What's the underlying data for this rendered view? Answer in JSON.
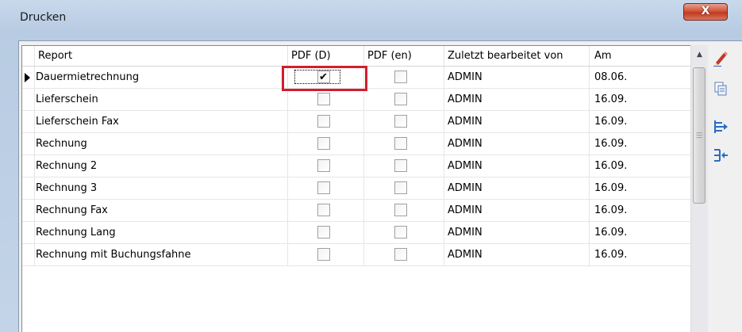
{
  "window": {
    "title": "Drucken",
    "close_label": "X"
  },
  "columns": {
    "report": "Report",
    "pdf_d": "PDF (D)",
    "pdf_en": "PDF (en)",
    "edited_by": "Zuletzt bearbeitet von",
    "date": "Am"
  },
  "rows": [
    {
      "report": "Dauermietrechnung",
      "pdf_d": true,
      "pdf_en": false,
      "edited_by": "ADMIN",
      "date": "08.06.",
      "selected": true
    },
    {
      "report": "Lieferschein",
      "pdf_d": false,
      "pdf_en": false,
      "edited_by": "ADMIN",
      "date": "16.09."
    },
    {
      "report": "Lieferschein Fax",
      "pdf_d": false,
      "pdf_en": false,
      "edited_by": "ADMIN",
      "date": "16.09."
    },
    {
      "report": "Rechnung",
      "pdf_d": false,
      "pdf_en": false,
      "edited_by": "ADMIN",
      "date": "16.09."
    },
    {
      "report": "Rechnung 2",
      "pdf_d": false,
      "pdf_en": false,
      "edited_by": "ADMIN",
      "date": "16.09."
    },
    {
      "report": "Rechnung 3",
      "pdf_d": false,
      "pdf_en": false,
      "edited_by": "ADMIN",
      "date": "16.09."
    },
    {
      "report": "Rechnung Fax",
      "pdf_d": false,
      "pdf_en": false,
      "edited_by": "ADMIN",
      "date": "16.09."
    },
    {
      "report": "Rechnung Lang",
      "pdf_d": false,
      "pdf_en": false,
      "edited_by": "ADMIN",
      "date": "16.09."
    },
    {
      "report": "Rechnung mit Buchungsfahne",
      "pdf_d": false,
      "pdf_en": false,
      "edited_by": "ADMIN",
      "date": "16.09."
    }
  ],
  "toolbar": {
    "icons": [
      "edit-pencil-icon",
      "copy-icon",
      "export-right-icon",
      "import-left-icon"
    ]
  },
  "colors": {
    "highlight_box": "#d21e2d",
    "close_button": "#c03a21",
    "pencil": "#c0392b",
    "toolbar_blue": "#2b6cc4"
  }
}
